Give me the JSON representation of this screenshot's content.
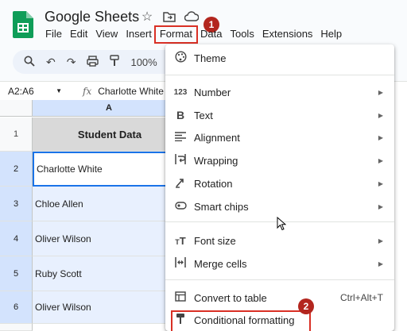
{
  "app": {
    "title": "Google Sheets",
    "menu": [
      "File",
      "Edit",
      "View",
      "Insert",
      "Format",
      "Data",
      "Tools",
      "Extensions",
      "Help"
    ],
    "active_menu": "Format"
  },
  "toolbar": {
    "zoom": "100%"
  },
  "formula_bar": {
    "name_box": "A2:A6",
    "fx": "fx",
    "value": "Charlotte White"
  },
  "grid": {
    "column_header": "A",
    "rows": [
      {
        "num": "1",
        "value": "Student Data"
      },
      {
        "num": "2",
        "value": "Charlotte White"
      },
      {
        "num": "3",
        "value": "Chloe Allen"
      },
      {
        "num": "4",
        "value": "Oliver Wilson"
      },
      {
        "num": "5",
        "value": "Ruby Scott"
      },
      {
        "num": "6",
        "value": "Oliver Wilson"
      }
    ]
  },
  "format_menu": {
    "theme": "Theme",
    "number": "Number",
    "text": "Text",
    "alignment": "Alignment",
    "wrapping": "Wrapping",
    "rotation": "Rotation",
    "smart_chips": "Smart chips",
    "font_size": "Font size",
    "merge_cells": "Merge cells",
    "convert_to_table": "Convert to table",
    "convert_shortcut": "Ctrl+Alt+T",
    "conditional_formatting": "Conditional formatting"
  },
  "annotations": {
    "step1": "1",
    "step2": "2"
  },
  "colors": {
    "accent_red": "#d93025",
    "badge": "#b3261e",
    "selection": "#d3e3fd",
    "sheets_green": "#0f9d58"
  }
}
